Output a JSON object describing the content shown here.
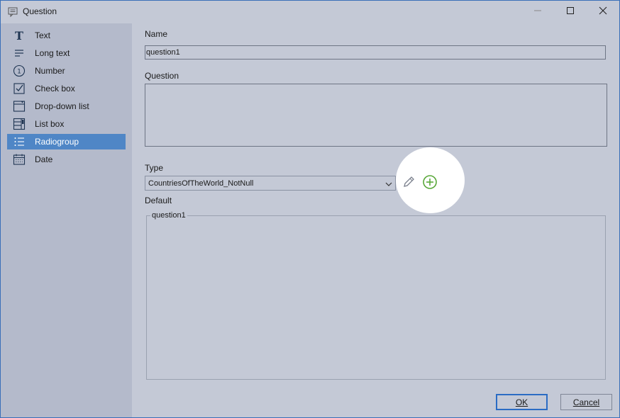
{
  "window": {
    "title": "Question",
    "icons": {
      "title": "comment-icon",
      "minimize": "minimize-icon",
      "maximize": "maximize-icon",
      "close": "close-icon"
    }
  },
  "sidebar": {
    "items": [
      {
        "label": "Text",
        "icon": "text-icon",
        "selected": false
      },
      {
        "label": "Long text",
        "icon": "long-text-icon",
        "selected": false
      },
      {
        "label": "Number",
        "icon": "number-icon",
        "selected": false
      },
      {
        "label": "Check box",
        "icon": "checkbox-icon",
        "selected": false
      },
      {
        "label": "Drop-down list",
        "icon": "dropdown-list-icon",
        "selected": false
      },
      {
        "label": "List box",
        "icon": "list-box-icon",
        "selected": false
      },
      {
        "label": "Radiogroup",
        "icon": "radiogroup-icon",
        "selected": true
      },
      {
        "label": "Date",
        "icon": "calendar-icon",
        "selected": false
      }
    ],
    "selected_color": "#4f86c6"
  },
  "form": {
    "name_label": "Name",
    "name_value": "question1",
    "question_label": "Question",
    "question_value": "",
    "type_label": "Type",
    "type_value": "CountriesOfTheWorld_NotNull",
    "default_label": "Default",
    "default_group_title": "question1",
    "icons": {
      "edit": "pencil-icon",
      "add": "add-circle-icon",
      "dropdown": "chevron-down-icon"
    },
    "add_icon_color": "#5aa83a"
  },
  "buttons": {
    "ok_label": "OK",
    "cancel_label": "Cancel"
  }
}
